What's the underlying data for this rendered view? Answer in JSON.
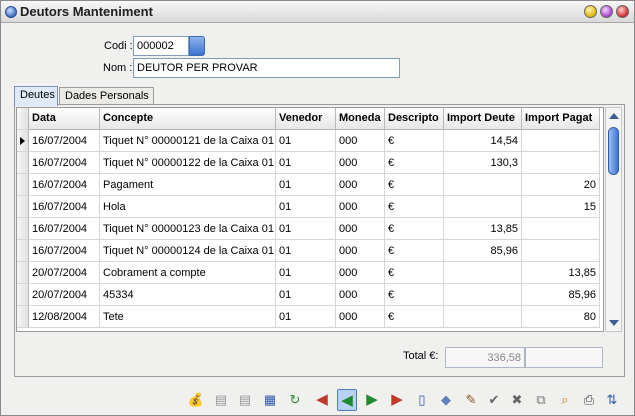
{
  "window": {
    "title": "Deutors Manteniment"
  },
  "form": {
    "codi_label": "Codi :",
    "codi_value": "000002",
    "nom_label": "Nom :",
    "nom_value": "DEUTOR PER PROVAR"
  },
  "tabs": [
    {
      "label": "Deutes"
    },
    {
      "label": "Dades Personals"
    }
  ],
  "grid": {
    "columns": [
      "Data",
      "Concepte",
      "Venedor",
      "Moneda",
      "Descripto",
      "Import Deute",
      "Import Pagat"
    ],
    "rows": [
      {
        "data": "16/07/2004",
        "concepte": "Tiquet N° 00000121 de la Caixa 01",
        "venedor": "01",
        "moneda": "000",
        "descripcio": "€",
        "import_deute": "14,54",
        "import_pagat": ""
      },
      {
        "data": "16/07/2004",
        "concepte": "Tiquet N° 00000122 de la Caixa 01",
        "venedor": "01",
        "moneda": "000",
        "descripcio": "€",
        "import_deute": "130,3",
        "import_pagat": ""
      },
      {
        "data": "16/07/2004",
        "concepte": "Pagament",
        "venedor": "01",
        "moneda": "000",
        "descripcio": "€",
        "import_deute": "",
        "import_pagat": "20"
      },
      {
        "data": "16/07/2004",
        "concepte": "Hola",
        "venedor": "01",
        "moneda": "000",
        "descripcio": "€",
        "import_deute": "",
        "import_pagat": "15"
      },
      {
        "data": "16/07/2004",
        "concepte": "Tiquet N° 00000123 de la Caixa 01",
        "venedor": "01",
        "moneda": "000",
        "descripcio": "€",
        "import_deute": "13,85",
        "import_pagat": ""
      },
      {
        "data": "16/07/2004",
        "concepte": "Tiquet N° 00000124 de la Caixa 01",
        "venedor": "01",
        "moneda": "000",
        "descripcio": "€",
        "import_deute": "85,96",
        "import_pagat": ""
      },
      {
        "data": "20/07/2004",
        "concepte": "Cobrament a compte",
        "venedor": "01",
        "moneda": "000",
        "descripcio": "€",
        "import_deute": "",
        "import_pagat": "13,85"
      },
      {
        "data": "20/07/2004",
        "concepte": "45334",
        "venedor": "01",
        "moneda": "000",
        "descripcio": "€",
        "import_deute": "",
        "import_pagat": "85,96"
      },
      {
        "data": "12/08/2004",
        "concepte": "Tete",
        "venedor": "01",
        "moneda": "000",
        "descripcio": "€",
        "import_deute": "",
        "import_pagat": "80"
      }
    ]
  },
  "totals": {
    "label": "Total €:",
    "import_deute": "336,58",
    "import_pagat": ""
  },
  "toolbar": {
    "icons": [
      "money-bag-icon",
      "copy-page-icon",
      "copy-page-2-icon",
      "grid-view-icon",
      "refresh-icon",
      "first-record-icon",
      "prev-record-icon",
      "next-record-icon",
      "last-record-icon",
      "new-record-icon",
      "erase-icon",
      "edit-tools-icon",
      "confirm-icon",
      "cancel-icon",
      "copy-icon",
      "search-icon",
      "print-icon",
      "sort-az-icon"
    ]
  }
}
